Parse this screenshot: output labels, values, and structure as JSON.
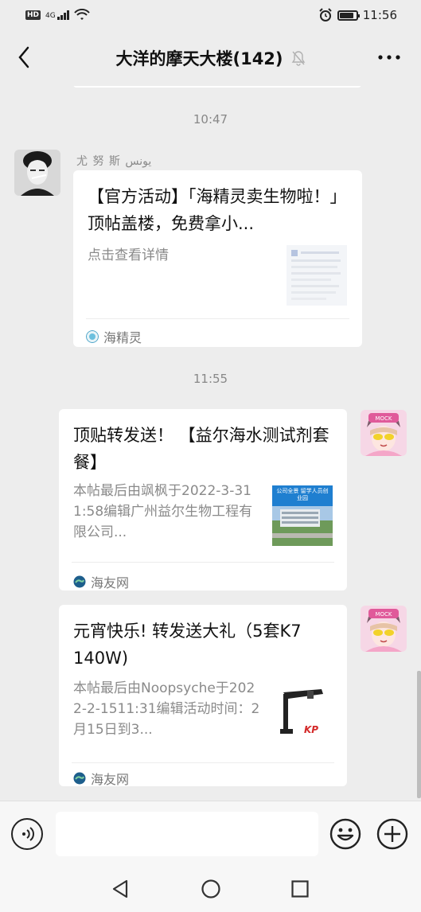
{
  "status_bar": {
    "hd": "HD",
    "network": "4G",
    "time": "11:56"
  },
  "header": {
    "title": "大洋的摩天大楼(142)",
    "back_icon": "chevron-left-icon",
    "mute_icon": "bell-off-icon",
    "more_icon": "more-icon"
  },
  "messages": [
    {
      "time": "10:47",
      "sender": "尤 努 斯 يونس",
      "card": {
        "title": "【官方活动】「海精灵卖生物啦！」顶帖盖楼，免费拿小...",
        "desc": "点击查看详情",
        "source": "海精灵"
      }
    },
    {
      "time": "11:55",
      "card": {
        "title": "顶贴转发送！ 【益尔海水测试剂套餐】",
        "desc": "本帖最后由飒枫于2022-3-311:58编辑广州益尔生物工程有限公司...",
        "source": "海友网",
        "thumb_text": "公司全景 留学人员创业园"
      }
    },
    {
      "card": {
        "title": "元宵快乐! 转发送大礼（5套K7 140W)",
        "desc": "本帖最后由Noopsyche于2022-2-1511:31编辑活动时间：2月15日到3...",
        "source": "海友网",
        "thumb_text": "KP"
      }
    }
  ],
  "input": {
    "placeholder": ""
  },
  "colors": {
    "background": "#ededed",
    "card": "#ffffff",
    "muted_text": "#8a8a8a",
    "source_green": "#1aad19"
  }
}
